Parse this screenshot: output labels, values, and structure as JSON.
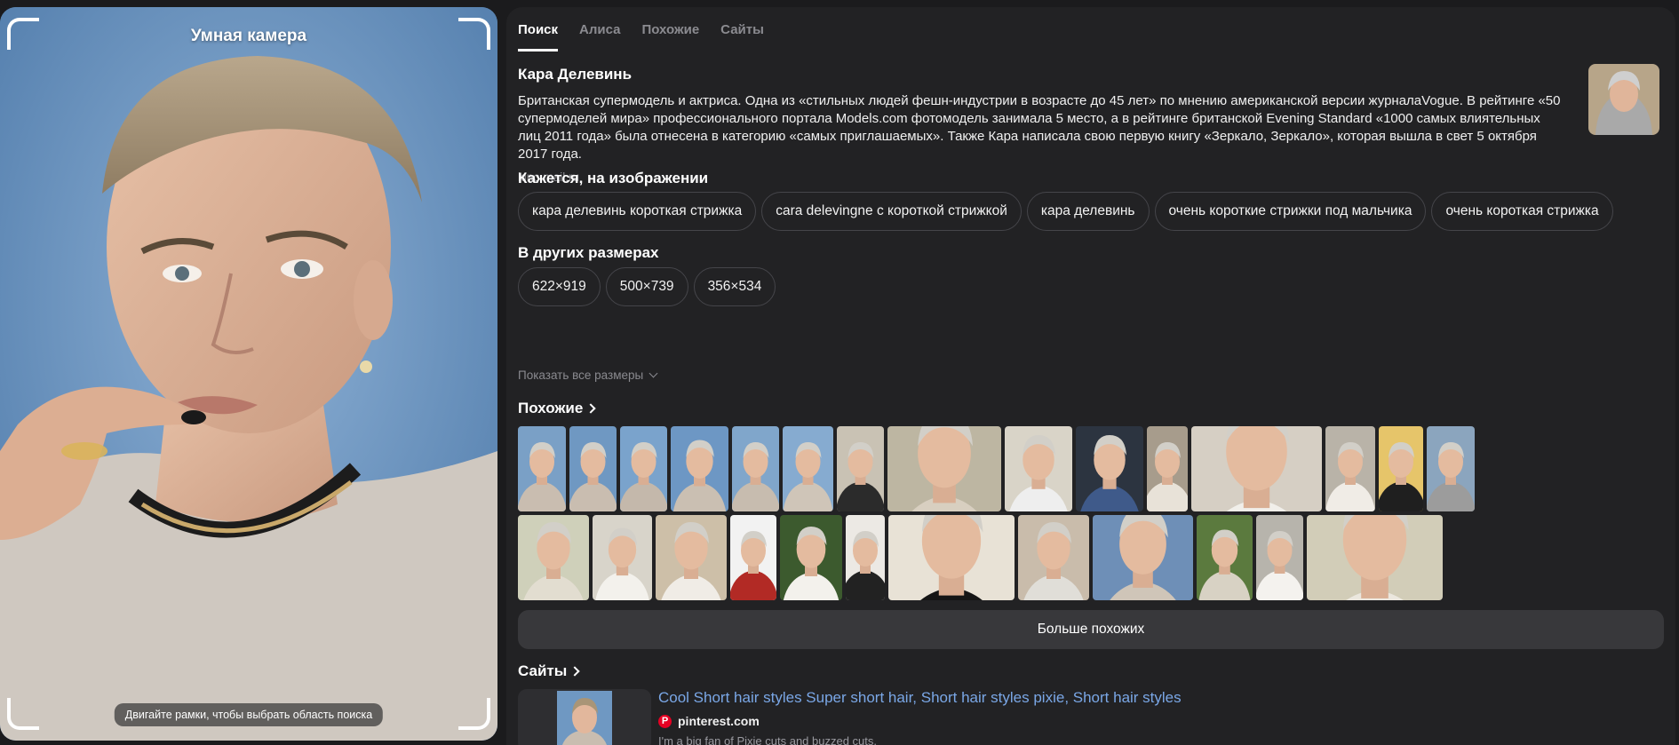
{
  "camera": {
    "title": "Умная камера",
    "hint": "Двигайте рамки, чтобы выбрать область поиска"
  },
  "tabs": [
    {
      "label": "Поиск",
      "active": true
    },
    {
      "label": "Алиса",
      "active": false
    },
    {
      "label": "Похожие",
      "active": false
    },
    {
      "label": "Сайты",
      "active": false
    }
  ],
  "entity": {
    "name": "Кара Делевинь",
    "description": "Британская супермодель и актриса. Одна из «стильных людей фешн-индустрии в возрасте до 45 лет» по мнению американской версии журналаVogue. В рейтинге «50 супермоделей мира» профессионального портала Models.com фотомодель занимала 5 место, а в рейтинге британской Evening Standard «1000 самых влиятельных лиц 2011 года» была отнесена в категорию «самых приглашаемых». Также Кара написала свою первую книгу «Зеркало, Зеркало», которая вышла в свет 5 октября 2017 года.",
    "source": "kino.mail.ru"
  },
  "tags": {
    "title": "Кажется, на изображении",
    "items": [
      "кара делевинь короткая стрижка",
      "cara delevingne с короткой стрижкой",
      "кара делевинь",
      "очень короткие стрижки под мальчика",
      "очень короткая стрижка"
    ]
  },
  "sizes": {
    "title": "В других размерах",
    "items": [
      "622×919",
      "500×739",
      "356×534"
    ],
    "show_all": "Показать все размеры"
  },
  "similar": {
    "title": "Похожие",
    "more_button": "Больше похожих",
    "row1": [
      {
        "bg": "#7aa0c6",
        "shirt": "#c9bdb0"
      },
      {
        "bg": "#6f98c2",
        "shirt": "#c9bdb0"
      },
      {
        "bg": "#7aa3cc",
        "shirt": "#c4b8ab"
      },
      {
        "bg": "#6d97c4",
        "shirt": "#cabfb2"
      },
      {
        "bg": "#80a6cb",
        "shirt": "#c7bcaf"
      },
      {
        "bg": "#86abd0",
        "shirt": "#cfc5b8"
      },
      {
        "bg": "#c9c2b4",
        "shirt": "#2b2b2b"
      },
      {
        "bg": "#bdb6a2",
        "shirt": "#d8cfc0"
      },
      {
        "bg": "#d9d4c8",
        "shirt": "#eeeeee"
      },
      {
        "bg": "#2c3440",
        "shirt": "#3f5a8a"
      },
      {
        "bg": "#a79c8c",
        "shirt": "#e8e2d8"
      },
      {
        "bg": "#d6cfc4",
        "shirt": "#f1efea"
      },
      {
        "bg": "#b9b3a8",
        "shirt": "#f0ece6"
      },
      {
        "bg": "#e6c56a",
        "shirt": "#1f1f1f"
      },
      {
        "bg": "#8ba5be",
        "shirt": "#9c9c9c"
      }
    ],
    "row2": [
      {
        "bg": "#cfd0ba",
        "shirt": "#e2ddd0"
      },
      {
        "bg": "#d8d4ca",
        "shirt": "#f3f1ec"
      },
      {
        "bg": "#cdbfa8",
        "shirt": "#f0ece6"
      },
      {
        "bg": "#f2f2f2",
        "shirt": "#b22a25"
      },
      {
        "bg": "#3c5a2e",
        "shirt": "#f3f1ec"
      },
      {
        "bg": "#ece9e4",
        "shirt": "#222222"
      },
      {
        "bg": "#e8e2d6",
        "shirt": "#151515"
      },
      {
        "bg": "#c9bcab",
        "shirt": "#e0ded8"
      },
      {
        "bg": "#6e8fb7",
        "shirt": "#cfc5b8"
      },
      {
        "bg": "#5b7a3e",
        "shirt": "#d8d2c4"
      },
      {
        "bg": "#b7b4ac",
        "shirt": "#f4f2ee"
      },
      {
        "bg": "#d2cdb8",
        "shirt": "#ebe7de"
      }
    ]
  },
  "sites": {
    "title": "Сайты",
    "first": {
      "title": "Cool Short hair styles Super short hair, Short hair styles pixie, Short hair styles",
      "domain": "pinterest.com",
      "snippet": "I'm a big fan of Pixie cuts and buzzed cuts."
    }
  },
  "colors": {
    "background": "#1b1b1d",
    "panel": "#222224",
    "link": "#7aa7e6",
    "pinterest": "#e60023"
  }
}
